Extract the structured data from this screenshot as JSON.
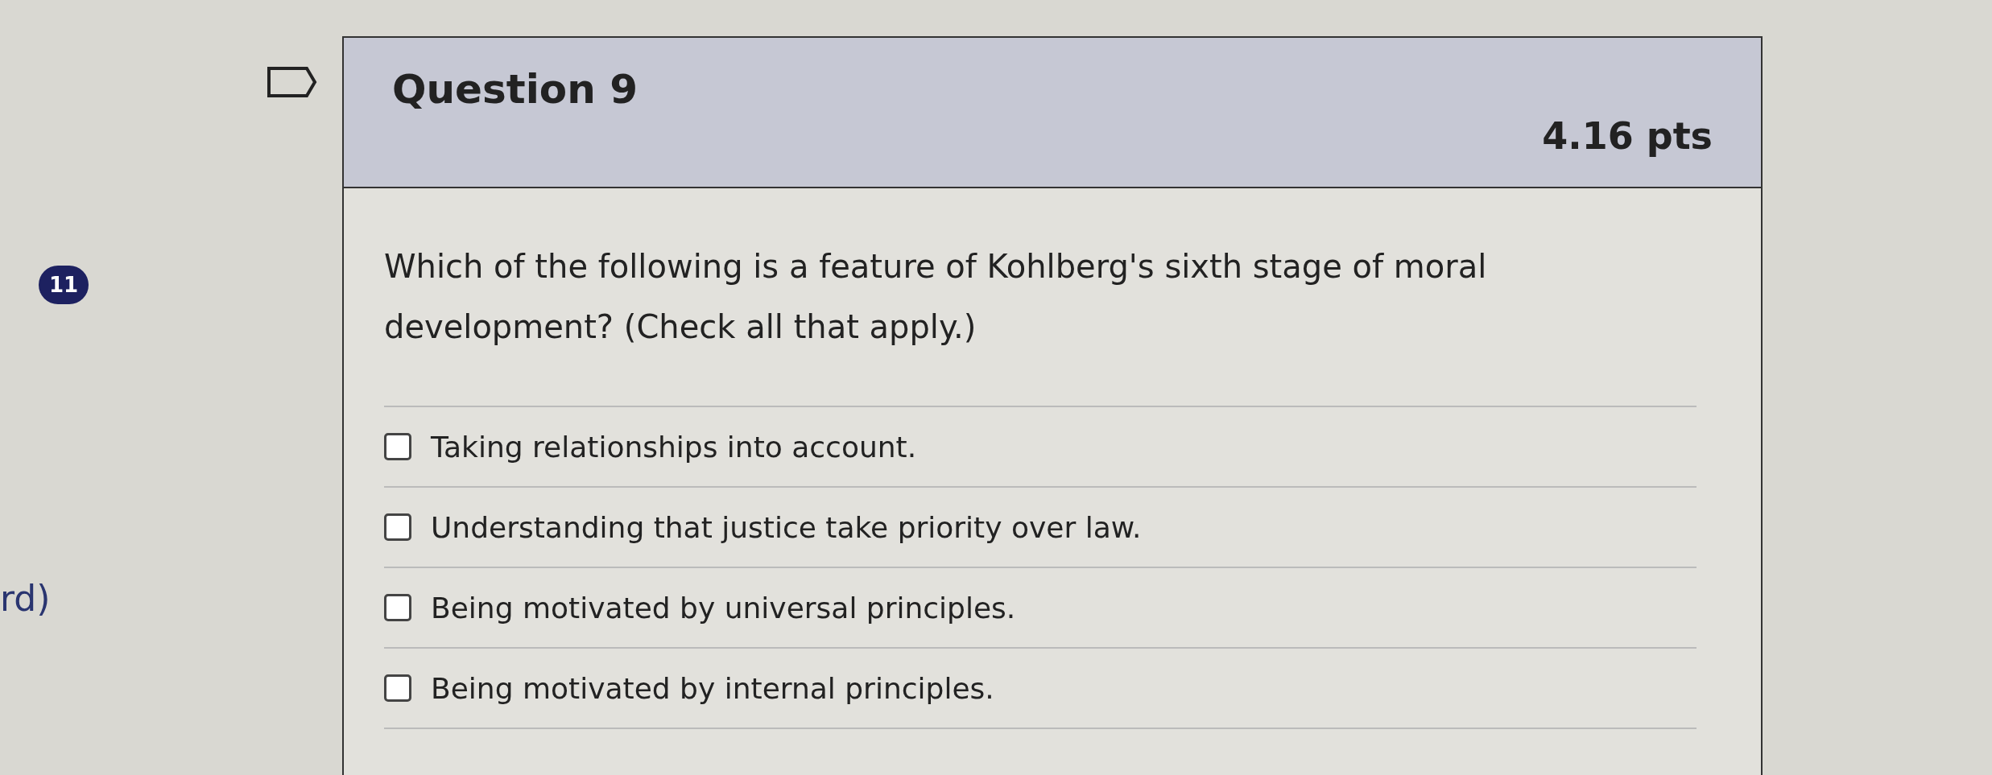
{
  "side_nav": {
    "badge": "11",
    "cut_label": "rd)"
  },
  "question": {
    "title": "Question 9",
    "points": "4.16 pts",
    "flagged": false,
    "prompt": "Which of the following is a feature of Kohlberg's sixth stage of moral development? (Check all that apply.)",
    "options": [
      {
        "label": "Taking relationships into account.",
        "checked": false
      },
      {
        "label": "Understanding that justice take priority over law.",
        "checked": false
      },
      {
        "label": "Being motivated by universal principles.",
        "checked": false
      },
      {
        "label": "Being motivated by internal principles.",
        "checked": false
      }
    ]
  }
}
